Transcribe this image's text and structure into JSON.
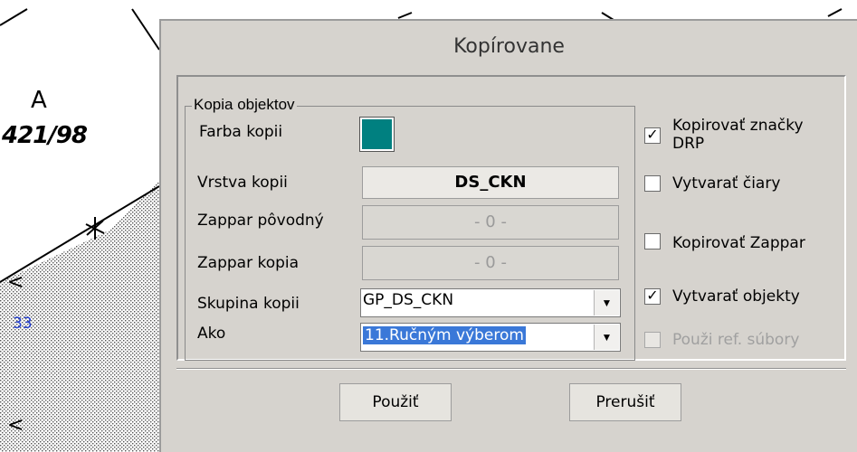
{
  "background": {
    "parcel_number": "421/98",
    "parcel_mark": "A",
    "blue_number": "33",
    "edge_glyph": "<"
  },
  "dialog": {
    "title": "Kopírovane",
    "group_title": "Kopia objektov",
    "color_label": "Farba kopii",
    "color_value": "#008080",
    "layer_label": "Vrstva kopii",
    "layer_value": "DS_CKN",
    "zappar_original_label": "Zappar pôvodný",
    "zappar_original_value": "- 0 -",
    "zappar_copy_label": "Zappar kopia",
    "zappar_copy_value": "- 0 -",
    "group_label": "Skupina kopii",
    "group_value": "GP_DS_CKN",
    "how_label": "Ako",
    "how_value": "11.Ručným výberom",
    "checkboxes": [
      {
        "line1": "Kopirovať značky",
        "line2": "DRP",
        "checked": true,
        "enabled": true
      },
      {
        "line1": "Vytvarať čiary",
        "line2": "",
        "checked": false,
        "enabled": true
      },
      {
        "line1": "Kopirovať Zappar",
        "line2": "",
        "checked": false,
        "enabled": true
      },
      {
        "line1": "Vytvarať objekty",
        "line2": "",
        "checked": true,
        "enabled": true
      },
      {
        "line1": "Použi ref. súbory",
        "line2": "",
        "checked": false,
        "enabled": false
      }
    ],
    "check_glyph": "✓",
    "dropdown_arrow": "▼",
    "apply_label": "Použiť",
    "cancel_label": "Prerušiť"
  }
}
